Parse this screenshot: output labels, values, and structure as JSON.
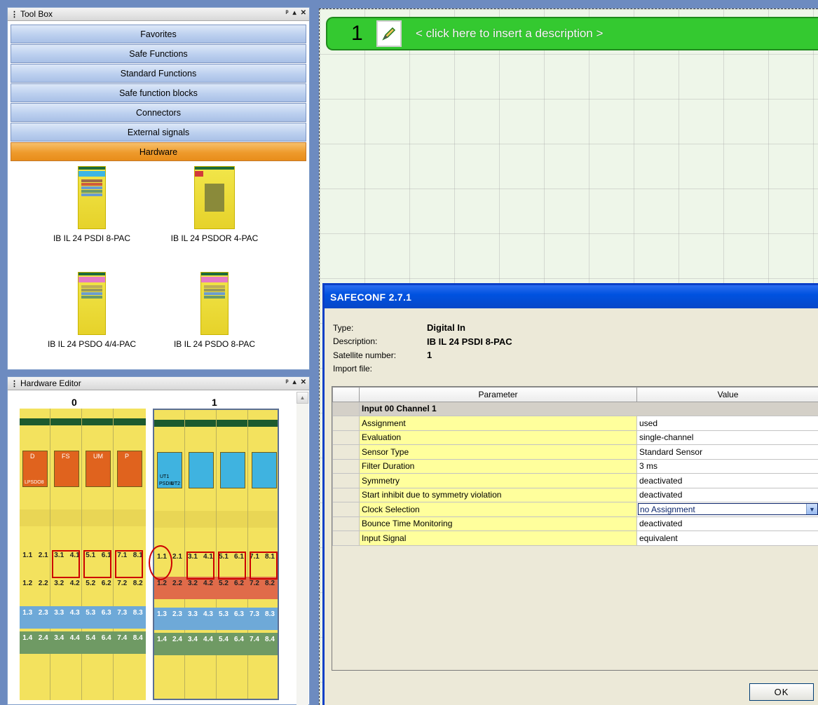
{
  "toolbox": {
    "title": "Tool Box",
    "categories": [
      {
        "label": "Favorites"
      },
      {
        "label": "Safe Functions"
      },
      {
        "label": "Standard Functions"
      },
      {
        "label": "Safe function blocks"
      },
      {
        "label": "Connectors"
      },
      {
        "label": "External signals"
      },
      {
        "label": "Hardware"
      }
    ],
    "active_category": "Hardware",
    "hardware_items": [
      {
        "label": "IB IL 24 PSDI 8-PAC"
      },
      {
        "label": "IB IL 24 PSDOR 4-PAC"
      },
      {
        "label": "IB IL 24 PSDO 4/4-PAC"
      },
      {
        "label": "IB IL 24 PSDO 8-PAC"
      }
    ]
  },
  "hardware_editor": {
    "title": "Hardware Editor",
    "columns": [
      "0",
      "1"
    ],
    "rack0_blocks": [
      "D",
      "FS",
      "UM",
      "P"
    ],
    "rack0_label": "LPSDO8",
    "rack1_label_a": "UT1",
    "rack1_label_b": "PSDI8",
    "rack1_label_c": "UT2",
    "term_row1": [
      "1.1",
      "2.1",
      "3.1",
      "4.1",
      "5.1",
      "6.1",
      "7.1",
      "8.1"
    ],
    "term_row2": [
      "1.2",
      "2.2",
      "3.2",
      "4.2",
      "5.2",
      "6.2",
      "7.2",
      "8.2"
    ],
    "term_row3": [
      "1.3",
      "2.3",
      "3.3",
      "4.3",
      "5.3",
      "6.3",
      "7.3",
      "8.3"
    ],
    "term_row4": [
      "1.4",
      "2.4",
      "3.4",
      "4.4",
      "5.4",
      "6.4",
      "7.4",
      "8.4"
    ]
  },
  "sheet": {
    "number": "1",
    "description_placeholder": "< click here to insert a description >"
  },
  "dialog": {
    "title": "SAFECONF 2.7.1",
    "type_label": "Type:",
    "type_value": "Digital In",
    "description_label": "Description:",
    "description_value": "IB IL 24 PSDI 8-PAC",
    "satellite_label": "Satellite number:",
    "satellite_value": "1",
    "import_label": "Import file:",
    "table": {
      "col_parameter": "Parameter",
      "col_value": "Value",
      "group": "Input 00 Channel 1",
      "rows": [
        {
          "param": "Assignment",
          "value": "used"
        },
        {
          "param": "Evaluation",
          "value": "single-channel"
        },
        {
          "param": "Sensor Type",
          "value": "Standard Sensor"
        },
        {
          "param": "Filter Duration",
          "value": "3 ms"
        },
        {
          "param": "Symmetry",
          "value": "deactivated"
        },
        {
          "param": "Start inhibit due to symmetry violation",
          "value": "deactivated"
        },
        {
          "param": "Clock Selection",
          "value": "no Assignment"
        },
        {
          "param": "Bounce Time Monitoring",
          "value": "deactivated"
        },
        {
          "param": "Input Signal",
          "value": "equivalent"
        }
      ]
    },
    "ok_label": "OK"
  },
  "colors": {
    "active_category": "#ee9a2c",
    "banner_green": "#34c930",
    "dialog_title": "#0052e0",
    "param_cell": "#ffff9c"
  }
}
